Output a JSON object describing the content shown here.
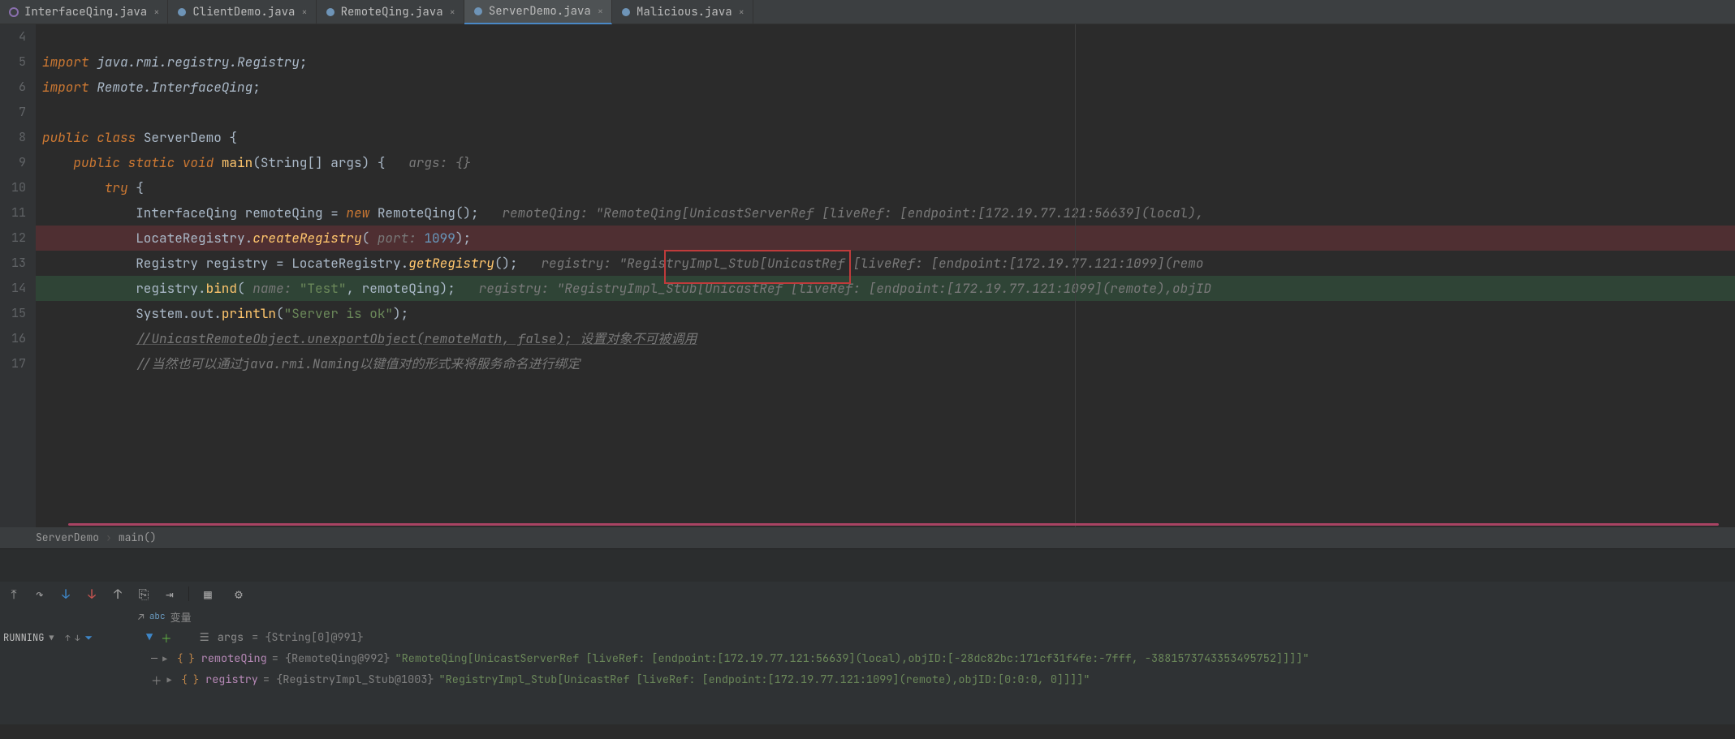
{
  "tabs": [
    {
      "label": "InterfaceQing.java",
      "iconType": "iface"
    },
    {
      "label": "ClientDemo.java",
      "iconType": "class"
    },
    {
      "label": "RemoteQing.java",
      "iconType": "class"
    },
    {
      "label": "ServerDemo.java",
      "iconType": "class",
      "active": true
    },
    {
      "label": "Malicious.java",
      "iconType": "class"
    }
  ],
  "gutter": [
    "4",
    "5",
    "6",
    "7",
    "8",
    "9",
    "10",
    "11",
    "12",
    "13",
    "14",
    "15",
    "16",
    "17"
  ],
  "code": {
    "l5_import": "import ",
    "l5_pkg": "java.rmi.registry.Registry",
    "l6_import": "import ",
    "l6_pkg": "Remote.InterfaceQing",
    "l8_pub": "public class ",
    "l8_cls": "ServerDemo ",
    "l9_sig1": "public static void ",
    "l9_main": "main",
    "l9_sig2": "(String[] args) {   ",
    "l9_hint": "args: {}",
    "l10_try": "try ",
    "l11_decl": "InterfaceQing remoteQing = ",
    "l11_new": "new ",
    "l11_ctor": "RemoteQing",
    "l11_end": "();   ",
    "l11_hint": "remoteQing: \"RemoteQing[UnicastServerRef [liveRef: [endpoint:[172.19.77.121:56639](local),",
    "l12_cls": "LocateRegistry.",
    "l12_meth": "createRegistry",
    "l12_paren": "( ",
    "l12_arg": "port: ",
    "l12_val": "1099",
    "l12_end": ");",
    "l13_type": "Registry ",
    "l13_var": "registry = LocateRegistry.",
    "l13_meth": "getRegistry",
    "l13_end": "();   ",
    "l13_hint": "registry: \"RegistryImpl_Stub[UnicastRef [liveRef: [endpoint:[172.19.77.121:1099](remo",
    "l14_1": "registry.",
    "l14_meth": "bind",
    "l14_2": "( ",
    "l14_arg": "name: ",
    "l14_str": "\"Test\"",
    "l14_3": ", remoteQing);   ",
    "l14_hint": "registry: \"RegistryImpl_Stub[UnicastRef [liveRef: [endpoint:[172.19.77.121:1099](remote),objID",
    "l15_1": "System.out.",
    "l15_m": "println",
    "l15_2": "(",
    "l15_s": "\"Server is ok\"",
    "l15_3": ");",
    "l16": "//UnicastRemoteObject.unexportObject(remoteMath, false); 设置对象不可被调用",
    "l17": "//当然也可以通过java.rmi.Naming以键值对的形式来将服务命名进行绑定"
  },
  "breadcrumb": {
    "a": "ServerDemo",
    "b": "main()"
  },
  "debug": {
    "varHeader": "变量",
    "status": "RUNNING",
    "argsLabel": "args",
    "argsValue": "= {String[0]@991}",
    "rows": [
      {
        "name": "remoteQing",
        "type": "= {RemoteQing@992}",
        "value": "\"RemoteQing[UnicastServerRef [liveRef: [endpoint:[172.19.77.121:56639](local),objID:[-28dc82bc:171cf31f4fe:-7fff, -3881573743353495752]]]]\""
      },
      {
        "name": "registry",
        "type": "= {RegistryImpl_Stub@1003}",
        "value": "\"RegistryImpl_Stub[UnicastRef [liveRef: [endpoint:[172.19.77.121:1099](remote),objID:[0:0:0, 0]]]]\""
      }
    ]
  }
}
